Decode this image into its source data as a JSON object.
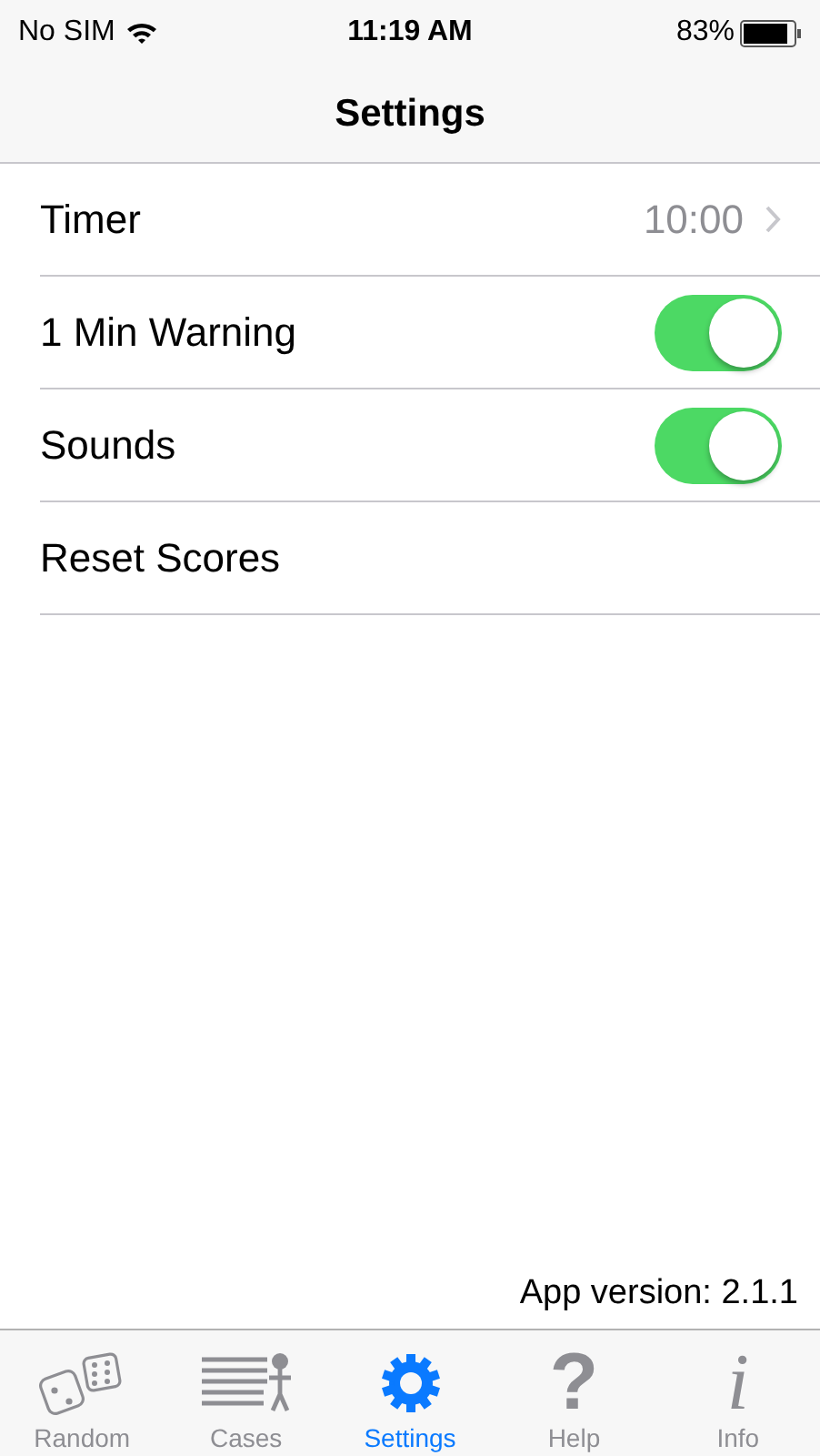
{
  "status_bar": {
    "carrier": "No SIM",
    "time": "11:19 AM",
    "battery": "83%"
  },
  "nav": {
    "title": "Settings"
  },
  "rows": [
    {
      "kind": "value",
      "label": "Timer",
      "value": "10:00"
    },
    {
      "kind": "toggle",
      "label": "1 Min Warning",
      "on": true
    },
    {
      "kind": "toggle",
      "label": "Sounds",
      "on": true
    },
    {
      "kind": "action",
      "label": "Reset Scores"
    }
  ],
  "footer": "App version: 2.1.1",
  "tabs": [
    {
      "label": "Random",
      "kind": "dice",
      "selected": false
    },
    {
      "label": "Cases",
      "kind": "list",
      "selected": false
    },
    {
      "label": "Settings",
      "kind": "gear",
      "selected": true
    },
    {
      "label": "Help",
      "kind": "glyph",
      "glyph": "?",
      "selected": false
    },
    {
      "label": "Info",
      "kind": "glyph",
      "glyph": "i",
      "selected": false
    }
  ]
}
